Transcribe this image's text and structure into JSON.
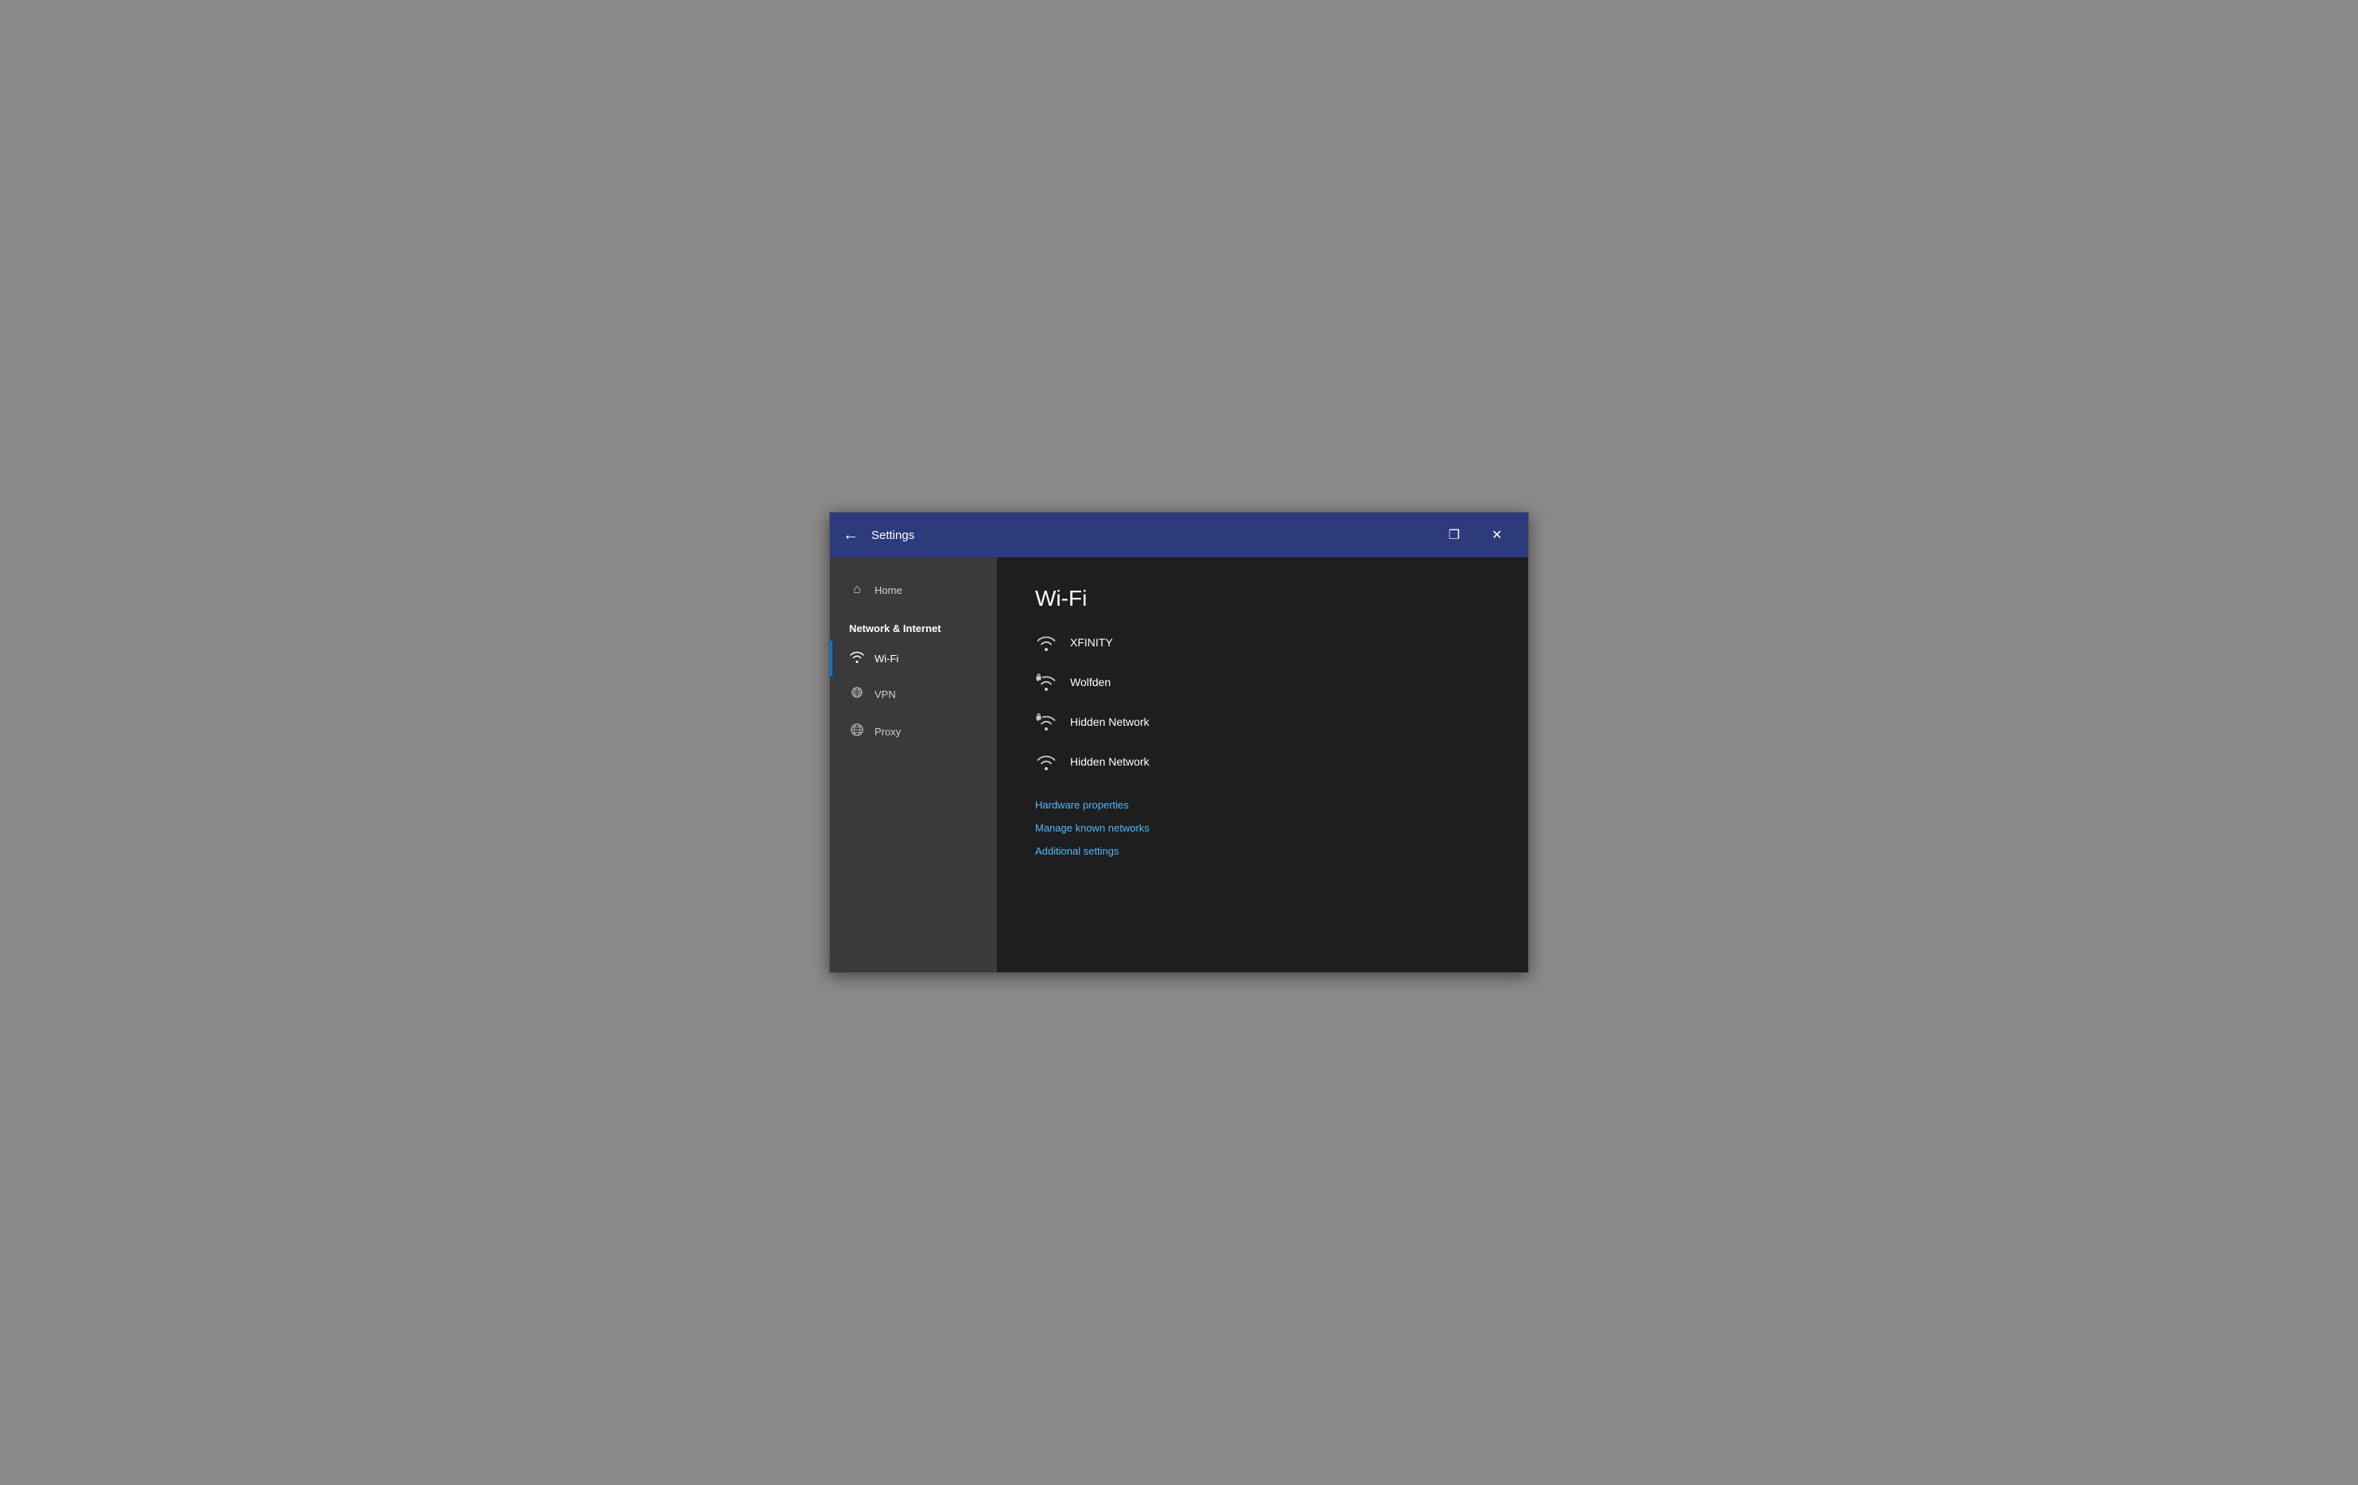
{
  "titlebar": {
    "back_label": "←",
    "title": "Settings",
    "restore_label": "❐",
    "close_label": "✕"
  },
  "sidebar": {
    "home_label": "Home",
    "section_label": "Network & Internet",
    "items": [
      {
        "id": "wifi",
        "label": "Wi-Fi",
        "icon": "wifi",
        "active": true
      },
      {
        "id": "vpn",
        "label": "VPN",
        "icon": "vpn",
        "active": false
      },
      {
        "id": "proxy",
        "label": "Proxy",
        "icon": "globe",
        "active": false
      }
    ]
  },
  "main": {
    "page_title": "Wi-Fi",
    "networks": [
      {
        "id": "xfinity",
        "name": "XFINITY",
        "locked": false
      },
      {
        "id": "wolfden",
        "name": "Wolfden",
        "locked": true
      },
      {
        "id": "hidden1",
        "name": "Hidden Network",
        "locked": true
      },
      {
        "id": "hidden2",
        "name": "Hidden Network",
        "locked": false
      }
    ],
    "links": [
      {
        "id": "hardware",
        "label": "Hardware properties"
      },
      {
        "id": "manage",
        "label": "Manage known networks"
      },
      {
        "id": "additional",
        "label": "Additional settings"
      }
    ]
  }
}
